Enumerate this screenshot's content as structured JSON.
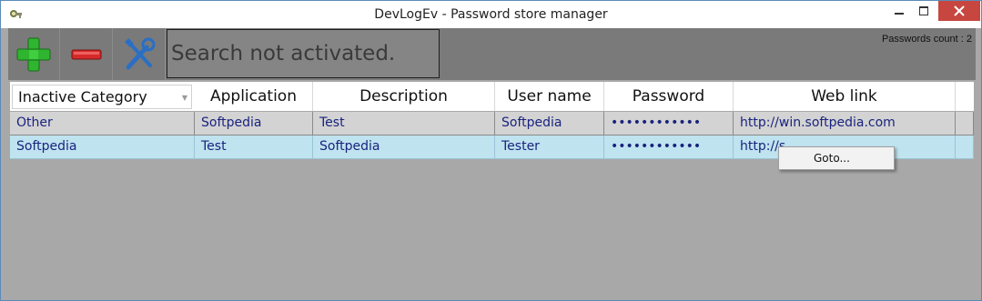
{
  "window": {
    "title": "DevLogEv - Password store manager"
  },
  "toolbar": {
    "add_icon": "plus-icon",
    "remove_icon": "minus-icon",
    "settings_icon": "tools-icon",
    "search_placeholder": "Search not activated.",
    "count_label": "Passwords count : 2"
  },
  "grid": {
    "columns": [
      "Inactive Category",
      "Application",
      "Description",
      "User name",
      "Password",
      "Web link"
    ],
    "rows": [
      {
        "category": "Other",
        "application": "Softpedia",
        "description": "Test",
        "user": "Softpedia",
        "password": "••••••••••••",
        "link": "http://win.softpedia.com"
      },
      {
        "category": "Softpedia",
        "application": "Test",
        "description": "Softpedia",
        "user": "Tester",
        "password": "••••••••••••",
        "link": "http://s"
      }
    ]
  },
  "context_menu": {
    "items": [
      "Goto..."
    ]
  },
  "colors": {
    "row_selected": "#bfe3ef",
    "text_link": "#1a237e",
    "close": "#c7463f"
  }
}
